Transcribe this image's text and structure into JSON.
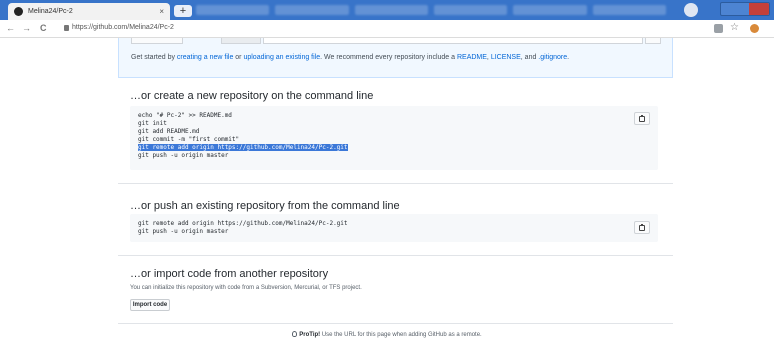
{
  "browser": {
    "tab_title": "Melina24/Pc-2",
    "tab_close": "×",
    "new_tab": "+",
    "back": "←",
    "forward": "→",
    "reload": "C",
    "url": "https://github.com/Melina24/Pc-2",
    "star": "☆"
  },
  "get_started": {
    "prefix": "Get started by ",
    "link1": "creating a new file",
    "middle1": " or ",
    "link2": "uploading an existing file",
    "middle2": ". We recommend every repository include a ",
    "link3": "README",
    "sep1": ", ",
    "link4": "LICENSE",
    "sep2": ", and ",
    "link5": ".gitignore",
    "suffix": "."
  },
  "create_section": {
    "title": "…or create a new repository on the command line",
    "lines": [
      "echo \"# Pc-2\" >> README.md",
      "git init",
      "git add README.md",
      "git commit -m \"first commit\"",
      "git remote add origin https://github.com/Melina24/Pc-2.git",
      "git push -u origin master"
    ]
  },
  "push_section": {
    "title": "…or push an existing repository from the command line",
    "lines": [
      "git remote add origin https://github.com/Melina24/Pc-2.git",
      "git push -u origin master"
    ]
  },
  "import_section": {
    "title": "…or import code from another repository",
    "description": "You can initialize this repository with code from a Subversion, Mercurial, or TFS project.",
    "button": "Import code"
  },
  "protip": {
    "label": "ProTip!",
    "text": " Use the URL for this page when adding GitHub as a remote."
  },
  "colors": {
    "link": "#0366d6",
    "selection": "#3b78d8",
    "chrome": "#3874c9"
  }
}
